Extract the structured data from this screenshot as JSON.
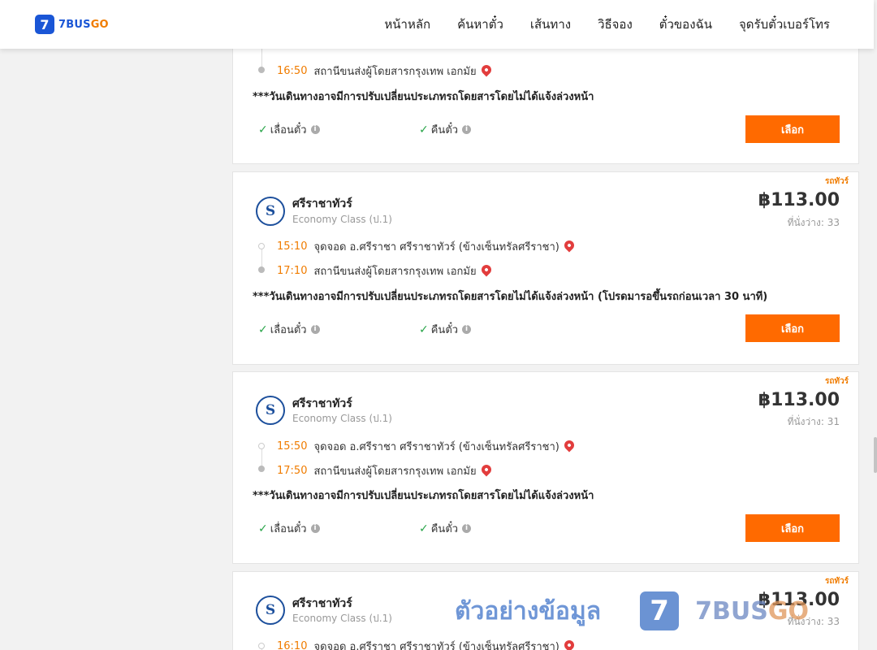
{
  "brand": {
    "badge": "7",
    "name_a": "7BUS",
    "name_b": "GO"
  },
  "nav": [
    "หน้าหลัก",
    "ค้นหาตั๋ว",
    "เส้นทาง",
    "วิธีจอง",
    "ตั๋วของฉัน",
    "จุดรับตั๋วเบอร์โทร"
  ],
  "common": {
    "change_ticket": "เลื่อนตั๋ว",
    "refund_ticket": "คืนตั๋ว",
    "select": "เลือก",
    "tag": "รถทัวร์",
    "check": "✓",
    "info": "i",
    "logo_mark": "S"
  },
  "cards": [
    {
      "arrive_time": "16:50",
      "arrive_place": "สถานีขนส่งผู้โดยสารกรุงเทพ เอกมัย",
      "note": "***วันเดินทางอาจมีการปรับเปลี่ยนประเภทรถโดยสารโดยไม่ได้แจ้งล่วงหน้า"
    },
    {
      "operator": "ศรีราชาทัวร์",
      "class": "Economy Class (ป.1)",
      "price": "฿113.00",
      "seats": "ที่นั่งว่าง: 33",
      "depart_time": "15:10",
      "depart_place": "จุดจอด อ.ศรีราชา ศรีราชาทัวร์ (ข้างเซ็นทรัลศรีราชา)",
      "arrive_time": "17:10",
      "arrive_place": "สถานีขนส่งผู้โดยสารกรุงเทพ เอกมัย",
      "note": "***วันเดินทางอาจมีการปรับเปลี่ยนประเภทรถโดยสารโดยไม่ได้แจ้งล่วงหน้า (โปรดมารอขึ้นรถก่อนเวลา 30 นาที)"
    },
    {
      "operator": "ศรีราชาทัวร์",
      "class": "Economy Class (ป.1)",
      "price": "฿113.00",
      "seats": "ที่นั่งว่าง: 31",
      "depart_time": "15:50",
      "depart_place": "จุดจอด อ.ศรีราชา ศรีราชาทัวร์ (ข้างเซ็นทรัลศรีราชา)",
      "arrive_time": "17:50",
      "arrive_place": "สถานีขนส่งผู้โดยสารกรุงเทพ เอกมัย",
      "note": "***วันเดินทางอาจมีการปรับเปลี่ยนประเภทรถโดยสารโดยไม่ได้แจ้งล่วงหน้า"
    },
    {
      "operator": "ศรีราชาทัวร์",
      "class": "Economy Class (ป.1)",
      "price": "฿113.00",
      "seats": "ที่นั่งว่าง: 33",
      "depart_time": "16:10",
      "depart_place": "จุดจอด อ.ศรีราชา ศรีราชาทัวร์ (ข้างเซ็นทรัลศรีราชา)"
    }
  ],
  "watermark": {
    "text": "ตัวอย่างข้อมูล",
    "badge": "7",
    "brand_a": "7BUS",
    "brand_b": "GO"
  },
  "colors": {
    "accent": "#ff6a00",
    "brand_blue": "#1a56d6",
    "time": "#f07c00",
    "check": "#2aa54a",
    "pin": "#e23d3d"
  }
}
